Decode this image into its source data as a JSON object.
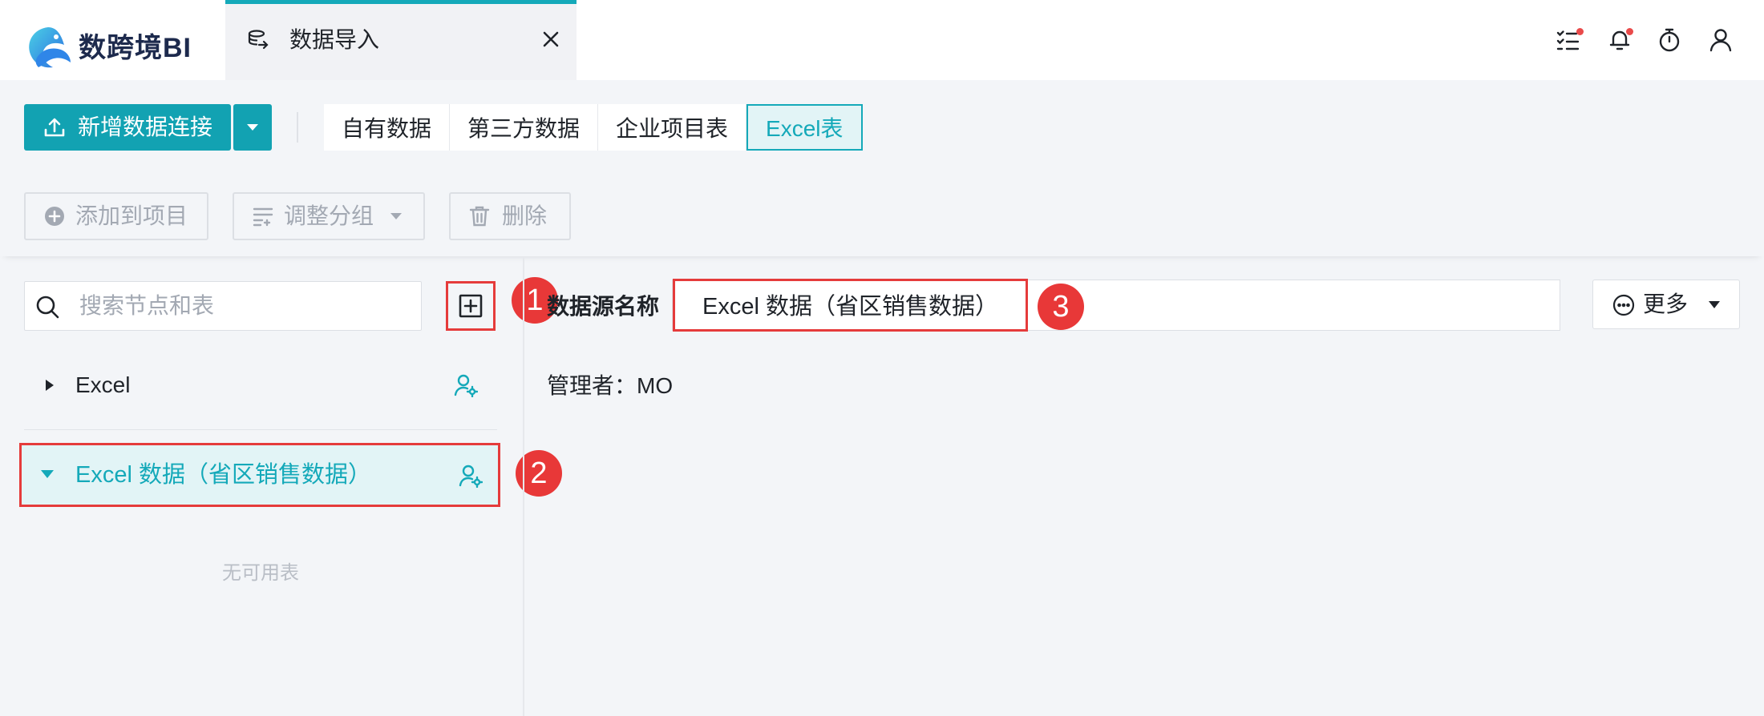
{
  "app": {
    "logo_text": "数跨境BI",
    "logo_icon": "fish-logo-icon"
  },
  "tab": {
    "label": "数据导入",
    "icon": "data-import-icon"
  },
  "header_icons": [
    "task-list-icon",
    "bell-icon",
    "timer-icon",
    "user-icon"
  ],
  "toolbar": {
    "new_connection_label": "新增数据连接",
    "source_tabs": [
      "自有数据",
      "第三方数据",
      "企业项目表",
      "Excel表"
    ],
    "active_source_tab": "Excel表",
    "add_to_project_label": "添加到项目",
    "adjust_group_label": "调整分组",
    "delete_label": "删除"
  },
  "left_panel": {
    "search_placeholder": "搜索节点和表",
    "tree": [
      {
        "label": "Excel",
        "expanded": false
      },
      {
        "label": "Excel 数据（省区销售数据）",
        "expanded": true,
        "selected": true
      }
    ],
    "empty_text": "无可用表"
  },
  "right_panel": {
    "ds_name_label": "数据源名称",
    "ds_name_value": "Excel 数据（省区销售数据）",
    "more_label": "更多",
    "manager_line": "管理者：MO"
  },
  "annotations": {
    "badge_1": "1",
    "badge_2": "2",
    "badge_3": "3"
  },
  "colors": {
    "accent": "#14a9b9",
    "button": "#12a2b2",
    "highlight": "#e53b3b",
    "background": "#f3f5f8"
  }
}
